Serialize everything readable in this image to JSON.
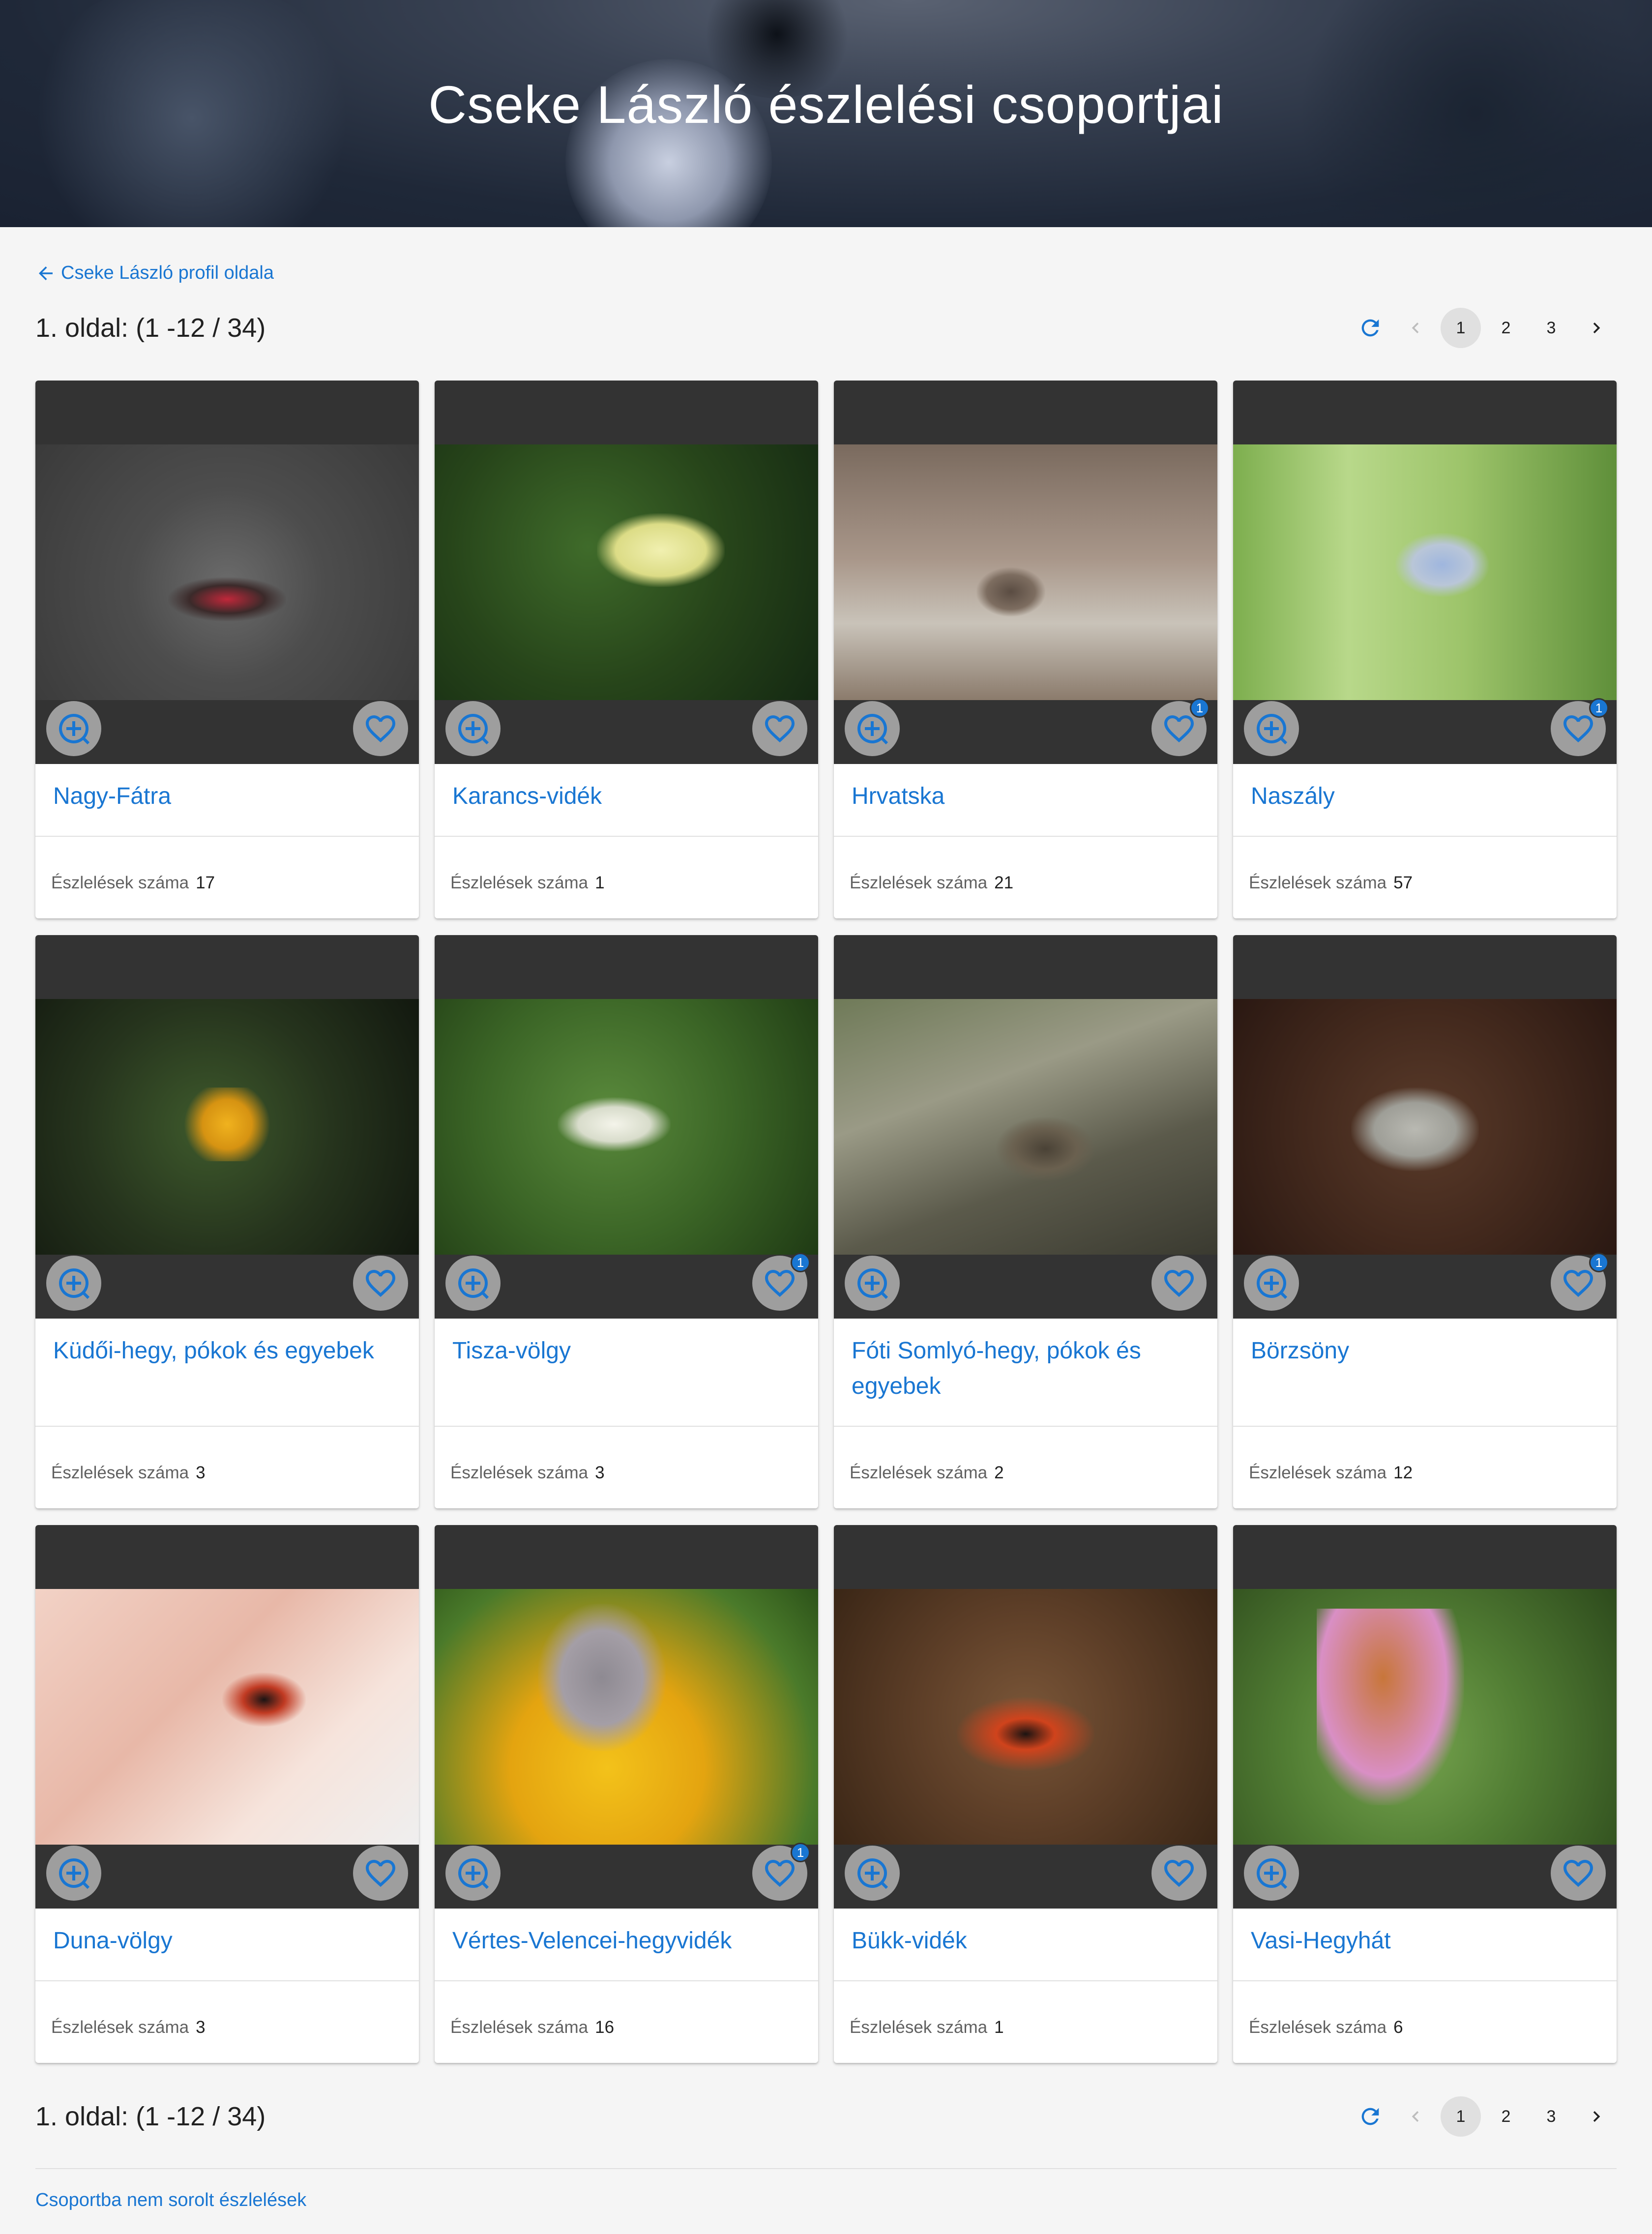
{
  "header": {
    "title": "Cseke László észlelési csoportjai"
  },
  "back_link": {
    "label": "Cseke László profil oldala"
  },
  "pagination_top": {
    "info": "1. oldal: (1 -12 / 34)",
    "pages": [
      "1",
      "2",
      "3"
    ],
    "current": "1"
  },
  "pagination_bottom": {
    "info": "1. oldal: (1 -12 / 34)",
    "pages": [
      "1",
      "2",
      "3"
    ],
    "current": "1"
  },
  "stat_label": "Észlelések száma",
  "groups": [
    {
      "name": "Nagy-Fátra",
      "count": "17",
      "badge": ""
    },
    {
      "name": "Karancs-vidék",
      "count": "1",
      "badge": ""
    },
    {
      "name": "Hrvatska",
      "count": "21",
      "badge": "1"
    },
    {
      "name": "Naszály",
      "count": "57",
      "badge": "1"
    },
    {
      "name": "Küdői-hegy, pókok és egyebek",
      "count": "3",
      "badge": ""
    },
    {
      "name": "Tisza-völgy",
      "count": "3",
      "badge": "1"
    },
    {
      "name": "Fóti Somlyó-hegy, pókok és egyebek",
      "count": "2",
      "badge": ""
    },
    {
      "name": "Börzsöny",
      "count": "12",
      "badge": "1"
    },
    {
      "name": "Duna-völgy",
      "count": "3",
      "badge": ""
    },
    {
      "name": "Vértes-Velencei-hegyvidék",
      "count": "16",
      "badge": "1"
    },
    {
      "name": "Bükk-vidék",
      "count": "1",
      "badge": ""
    },
    {
      "name": "Vasi-Hegyhát",
      "count": "6",
      "badge": ""
    }
  ],
  "footer_link": {
    "label": "Csoportba nem sorolt észlelések"
  },
  "colors": {
    "accent": "#1976d2",
    "media_bg": "#333333",
    "button_bg": "#9e9e9e"
  },
  "icons": {
    "zoom": "zoom-in-icon",
    "favorite": "heart-outline-icon",
    "refresh": "refresh-icon",
    "back": "arrow-left-icon"
  }
}
